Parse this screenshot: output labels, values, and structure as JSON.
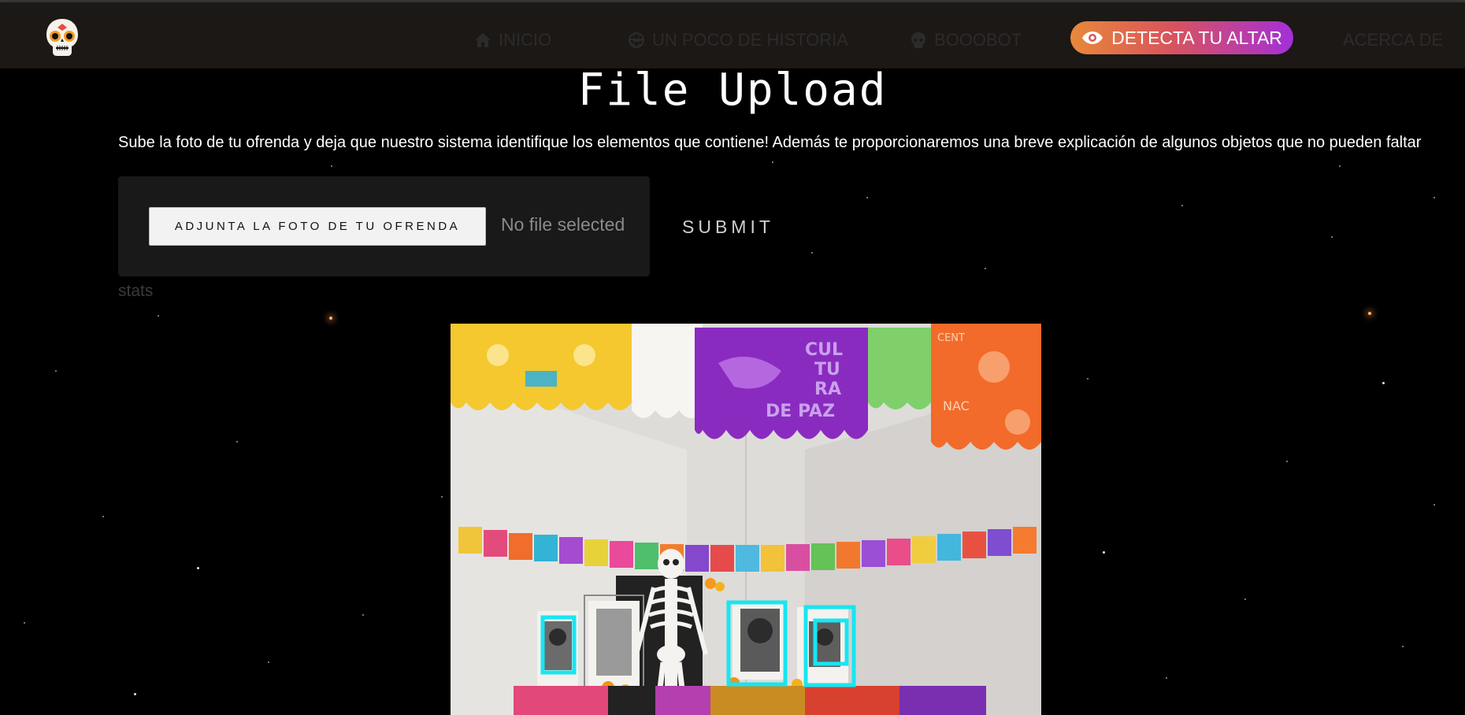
{
  "nav": {
    "items": [
      {
        "label": "INICIO",
        "icon": "home-icon"
      },
      {
        "label": "UN POCO DE HISTORIA",
        "icon": "globe-icon"
      },
      {
        "label": "BOOOBOT",
        "icon": "skull-icon"
      },
      {
        "label": "ACERCA DE",
        "icon": ""
      }
    ],
    "cta": {
      "label": "DETECTA TU ALTAR",
      "icon": "eye-icon"
    },
    "logo_icon": "sugar-skull-icon"
  },
  "page": {
    "title": "File Upload",
    "subtitle": "Sube la foto de tu ofrenda y deja que nuestro sistema identifique los elementos que contiene! Además te proporcionaremos una breve explicación de algunos objetos que no pueden faltar",
    "file_button_label": "ADJUNTA LA FOTO DE TU OFRENDA",
    "file_status": "No file selected",
    "submit_label": "SUBMIT",
    "stats_label": "stats"
  },
  "result_image": {
    "banner_text": [
      "CUL",
      "TU",
      "RA",
      "DE PAZ"
    ],
    "side_banner_text": [
      "CENT",
      "NAC"
    ],
    "detection_box_color": "#17e6f2",
    "detected_faces": 4
  },
  "colors": {
    "nav_bg": "#1b1816",
    "cta_gradient_start": "#e8893a",
    "cta_gradient_end": "#a42fd8",
    "page_bg": "#000000"
  }
}
